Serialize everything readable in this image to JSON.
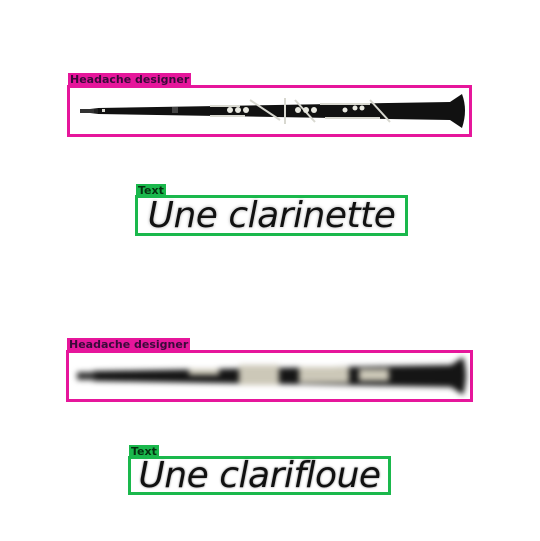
{
  "detections": [
    {
      "kind": "clarinet",
      "label": "Headache designer",
      "clarinet_icon": "clarinet-sharp"
    },
    {
      "kind": "text",
      "label": "Text",
      "caption": "Une clarinette"
    },
    {
      "kind": "clarinet",
      "label": "Headache designer",
      "clarinet_icon": "clarinet-blurred"
    },
    {
      "kind": "text",
      "label": "Text",
      "caption": "Une clarifloue"
    }
  ],
  "colors": {
    "clarinet_box": "#e6169b",
    "text_box": "#1ab84c",
    "clarinet_body": "#111111",
    "keys": "#d8d8d0"
  }
}
